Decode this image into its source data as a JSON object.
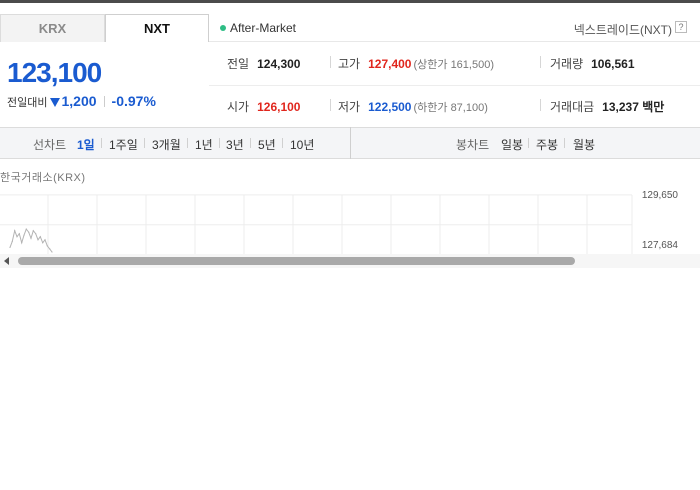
{
  "tabs": [
    {
      "label": "KRX"
    },
    {
      "label": "NXT"
    }
  ],
  "session": {
    "label": "After-Market",
    "status_color": "#2ebd85"
  },
  "market_name": "넥스트레이드(NXT)",
  "help_icon": "?",
  "price": {
    "current": "123,100",
    "change_label": "전일대비",
    "change_direction": "down",
    "change_amount": "1,200",
    "change_percent": "-0.97%",
    "color": "#1a5bd0"
  },
  "info": {
    "prev_close": {
      "label": "전일",
      "value": "124,300"
    },
    "high": {
      "label": "고가",
      "value": "127,400",
      "sub": "(상한가 161,500)"
    },
    "volume": {
      "label": "거래량",
      "value": "106,561"
    },
    "open": {
      "label": "시가",
      "value": "126,100"
    },
    "low": {
      "label": "저가",
      "value": "122,500",
      "sub": "(하한가 87,100)"
    },
    "turnover": {
      "label": "거래대금",
      "value": "13,237 백만"
    }
  },
  "colors": {
    "up": "#e0261d",
    "down": "#1a5bd0"
  },
  "line_chart": {
    "title": "선차트",
    "ranges": [
      "1일",
      "1주일",
      "3개월",
      "1년",
      "3년",
      "5년",
      "10년"
    ],
    "active": "1일"
  },
  "candle_chart": {
    "title": "봉차트",
    "ranges": [
      "일봉",
      "주봉",
      "월봉"
    ]
  },
  "chart_data": {
    "type": "line",
    "title": "한국거래소(KRX)",
    "y_ticks": [
      "129,650",
      "127,684"
    ],
    "series": [
      {
        "values": [
          126200,
          126600,
          127300,
          126900,
          127100,
          126500,
          127000,
          127400,
          127200,
          126800,
          127300,
          127100,
          126700,
          126900,
          126500,
          126700,
          126300,
          126100,
          125900
        ]
      }
    ],
    "ylim": [
      125700,
      130300
    ]
  }
}
